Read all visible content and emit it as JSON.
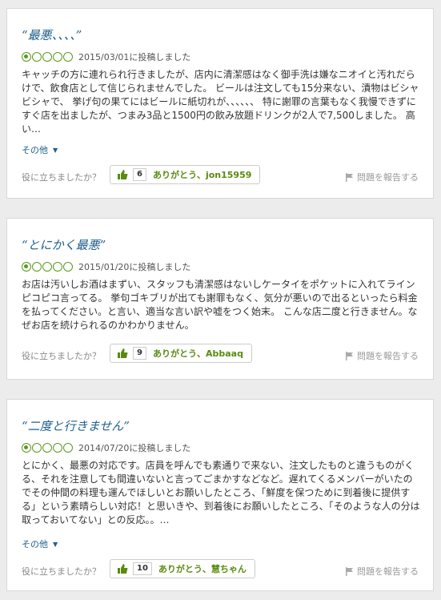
{
  "reviews": [
    {
      "title": "“最悪、、、、”",
      "date": "2015/03/01に投稿しました",
      "rating": 1,
      "body": "キャッチの方に連れられ行きましたが、店内に清潔感はなく御手洗は嫌なニオイと汚れだらけで、飲食店として信じられませんでした。 ビールは注文しても15分来ない、漬物はビシャビシャで、 挙げ句の果てにはビールに紙切れが、、、、、、 特に謝罪の言葉もなく我慢できずにすぐ店を出ましたが、つまみ3品と1500円の飲み放題ドリンクが2人で7,500しました。 高い…",
      "more_label": "その他",
      "helpful_question": "役に立ちましたか？",
      "thanks_count": "6",
      "thanks_label": "ありがとう、jon15959",
      "report_label": "問題を報告する"
    },
    {
      "title": "“とにかく最悪”",
      "date": "2015/01/20に投稿しました",
      "rating": 1,
      "body": "お店は汚いしお酒はまずい、スタッフも清潔感はないしケータイをポケットに入れてラインピコピコ言ってる。 挙句ゴキブリが出ても謝罪もなく、気分が悪いので出るといったら料金を払ってください。と言い、適当な言い訳や嘘をつく始末。 こんな店二度と行きません。なぜお店を続けられるのかわかりません。",
      "helpful_question": "役に立ちましたか？",
      "thanks_count": "9",
      "thanks_label": "ありがとう、Abbaaq",
      "report_label": "問題を報告する"
    },
    {
      "title": "“二度と行きません”",
      "date": "2014/07/20に投稿しました",
      "rating": 1,
      "body": "とにかく、最悪の対応です。店員を呼んでも素通りで来ない、注文したものと違うものがくる、それを注意しても間違いないと言ってごまかすなどなど。遅れてくるメンバーがいたのでその仲間の料理も運んでほしいとお願いしたところ、「鮮度を保つために到着後に提供する」という素晴らしい対応！と思いきや、到着後にお願いしたところ、「そのような人の分は取っておいてない」との反応。。…",
      "more_label": "その他",
      "helpful_question": "役に立ちましたか？",
      "thanks_count": "10",
      "thanks_label": "ありがとう、慧ちゃん",
      "report_label": "問題を報告する"
    }
  ],
  "colors": {
    "title": "#1e5f8c",
    "rating": "#5a9a1a",
    "thanks": "#5a8a10"
  },
  "icons": [
    "bubble-rating-icon",
    "thumbs-up-icon",
    "flag-icon",
    "caret-down-icon"
  ]
}
